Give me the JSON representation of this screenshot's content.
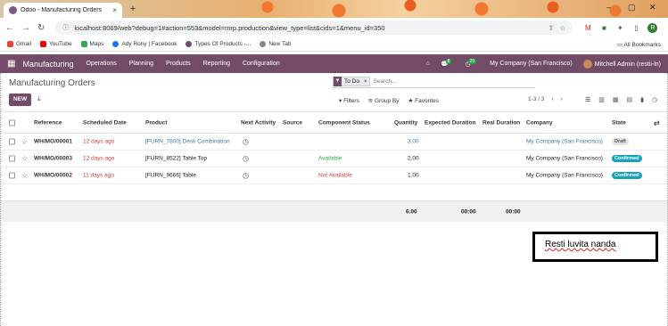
{
  "browser": {
    "tab_title": "Odoo - Manufacturing Orders",
    "url": "localhost:8069/web?debug=1#action=553&model=mrp.production&view_type=list&cids=1&menu_id=350",
    "profile_initial": "R",
    "bookmarks": [
      {
        "label": "Gmail",
        "color": "#ea4335"
      },
      {
        "label": "YouTube",
        "color": "#ff0000"
      },
      {
        "label": "Maps",
        "color": "#34a853"
      },
      {
        "label": "Ady Rony | Facebook",
        "color": "#1877f2"
      },
      {
        "label": "Types Of Products -...",
        "color": "#714b67"
      },
      {
        "label": "New Tab",
        "color": "#888888"
      }
    ],
    "all_bookmarks": "All Bookmarks"
  },
  "navbar": {
    "app_name": "Manufacturing",
    "menus": [
      "Operations",
      "Planning",
      "Products",
      "Reporting",
      "Configuration"
    ],
    "messages_count": "8",
    "activities_count": "20",
    "company": "My Company (San Francisco)",
    "user": "Mitchell Admin (restii-ln)",
    "accent": "#714b67"
  },
  "control_panel": {
    "breadcrumb": "Manufacturing Orders",
    "new_label": "NEW",
    "facet_label": "To Do",
    "search_placeholder": "Search...",
    "filters_label": "Filters",
    "group_by_label": "Group By",
    "favorites_label": "Favorites",
    "pager": "1-3 / 3"
  },
  "table": {
    "columns": [
      "Reference",
      "Scheduled Date",
      "Product",
      "Next Activity",
      "Source",
      "Component Status",
      "Quantity",
      "Expected Duration",
      "Real Duration",
      "Company",
      "State"
    ],
    "rows": [
      {
        "reference": "WH/MO/00001",
        "scheduled": "12 days ago",
        "product": "[FURN_7800] Desk Combination",
        "component_status": "",
        "quantity": "3.00",
        "company": "My Company (San Francisco)",
        "state": "Draft"
      },
      {
        "reference": "WH/MO/00003",
        "scheduled": "12 days ago",
        "product": "[FURN_8522] Table Top",
        "component_status": "Available",
        "quantity": "2.00",
        "company": "My Company (San Francisco)",
        "state": "Confirmed"
      },
      {
        "reference": "WH/MO/00002",
        "scheduled": "11 days ago",
        "product": "[FURN_9666] Table",
        "component_status": "Not Available",
        "quantity": "1.00",
        "company": "My Company (San Francisco)",
        "state": "Confirmed"
      }
    ],
    "totals": {
      "quantity": "6.00",
      "expected_duration": "00:00",
      "real_duration": "00:00"
    }
  },
  "annotation": "Resti luvita nanda"
}
